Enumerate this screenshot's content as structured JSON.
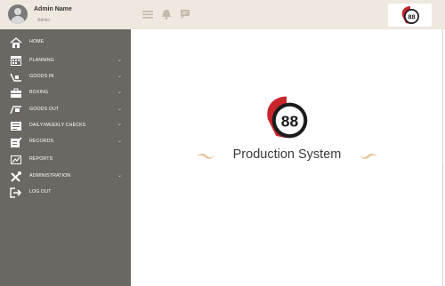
{
  "user": {
    "name": "Admin Name",
    "role": "Admin"
  },
  "menu": [
    {
      "label": "HOME",
      "icon": "home-icon",
      "has_submenu": false
    },
    {
      "label": "PLANNING",
      "icon": "calendar-icon",
      "has_submenu": true
    },
    {
      "label": "GOODS IN",
      "icon": "goods-in-icon",
      "has_submenu": true
    },
    {
      "label": "BOXING",
      "icon": "briefcase-icon",
      "has_submenu": true
    },
    {
      "label": "GOODS OUT",
      "icon": "cart-icon",
      "has_submenu": true
    },
    {
      "label": "DAILY/WEEKLY CHECKS",
      "icon": "checklist-icon",
      "has_submenu": true
    },
    {
      "label": "RECORDS",
      "icon": "records-icon",
      "has_submenu": true
    },
    {
      "label": "REPORTS",
      "icon": "reports-icon",
      "has_submenu": false
    },
    {
      "label": "ADMINISTRATION",
      "icon": "tools-icon",
      "has_submenu": true
    },
    {
      "label": "LOG OUT",
      "icon": "logout-icon",
      "has_submenu": false
    }
  ],
  "chevron": "⌄",
  "topbar": {
    "icons": [
      "hamburger-menu-icon",
      "bell-icon",
      "chat-icon"
    ]
  },
  "logo": {
    "number": "88"
  },
  "main": {
    "title": "Production System"
  },
  "colors": {
    "sidebar": "#6b6763",
    "header": "#efe8de",
    "logo_red": "#c8262c",
    "logo_dark": "#1c1c1c",
    "swash": "#e8c9a0"
  }
}
